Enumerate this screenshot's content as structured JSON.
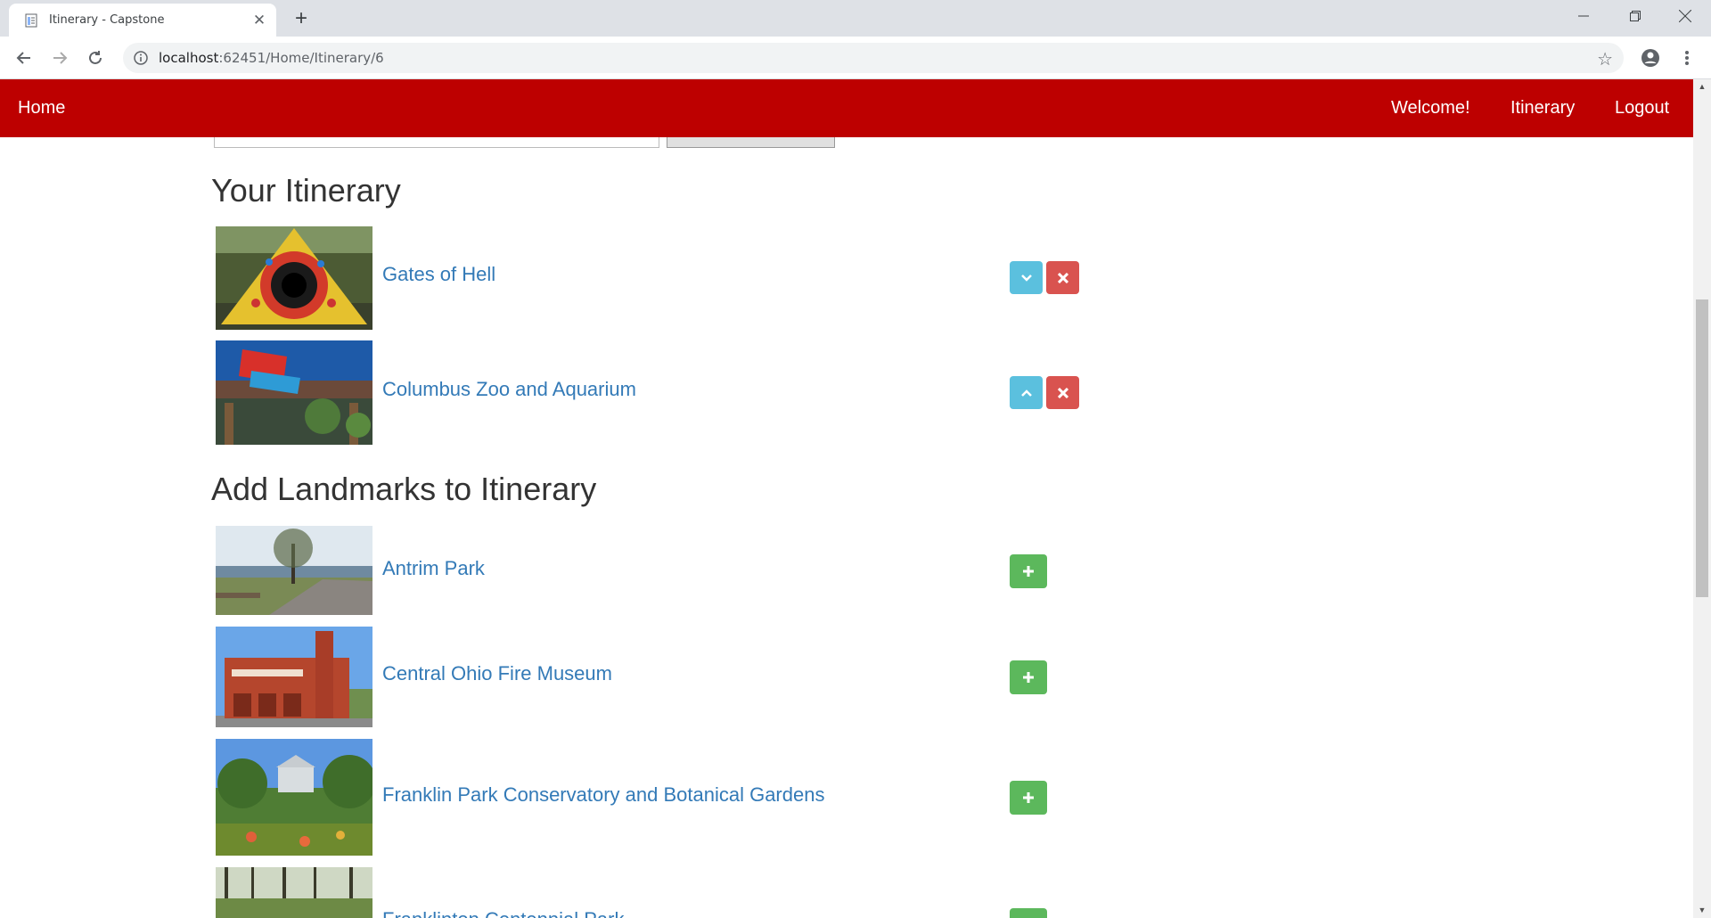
{
  "browser": {
    "tab_title": "Itinerary - Capstone",
    "url_host": "localhost",
    "url_path": ":62451/Home/Itinerary/6"
  },
  "navbar": {
    "home": "Home",
    "welcome": "Welcome!",
    "itinerary": "Itinerary",
    "logout": "Logout",
    "color": "#bd0000"
  },
  "itinerary": {
    "heading": "Your Itinerary",
    "items": [
      {
        "name": "Gates of Hell",
        "move_icon": "chevron-down-icon"
      },
      {
        "name": "Columbus Zoo and Aquarium",
        "move_icon": "chevron-up-icon"
      }
    ]
  },
  "landmarks": {
    "heading": "Add Landmarks to Itinerary",
    "items": [
      {
        "name": "Antrim Park"
      },
      {
        "name": "Central Ohio Fire Museum"
      },
      {
        "name": "Franklin Park Conservatory and Botanical Gardens"
      },
      {
        "name": "Franklinton Centennial Park"
      }
    ]
  },
  "colors": {
    "link": "#337ab7",
    "btn_info": "#5bc0de",
    "btn_danger": "#d9534f",
    "btn_success": "#5cb85c"
  }
}
